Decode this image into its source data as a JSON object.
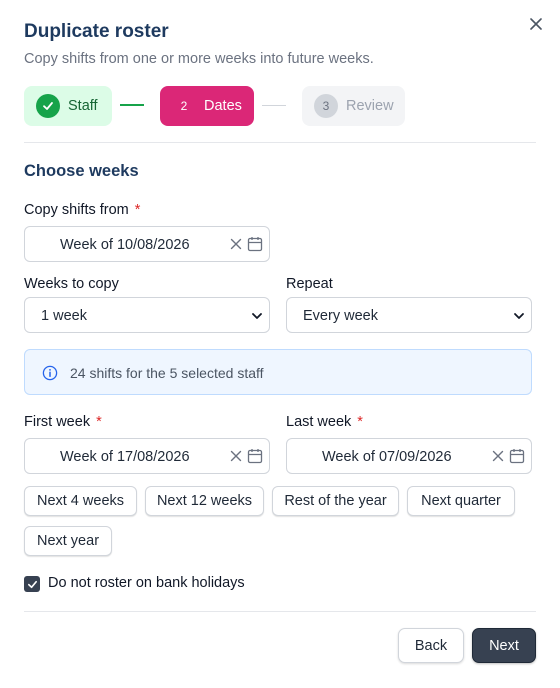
{
  "dialog": {
    "title": "Duplicate roster",
    "subtitle": "Copy shifts from one or more weeks into future weeks.",
    "close_icon": "close-icon"
  },
  "stepper": {
    "steps": [
      {
        "label": "Staff",
        "state": "complete",
        "icon": "check-icon"
      },
      {
        "number": "2",
        "label": "Dates",
        "state": "active"
      },
      {
        "number": "3",
        "label": "Review",
        "state": "upcoming"
      }
    ],
    "colors": {
      "complete": "#16a34a",
      "active": "#db2777",
      "upcoming": "#9ca3af"
    }
  },
  "section_title": "Choose weeks",
  "copy_from": {
    "label": "Copy shifts from",
    "required_mark": "*",
    "value": "Week of 10/08/2026"
  },
  "weeks_to_copy": {
    "label": "Weeks to copy",
    "value": "1 week"
  },
  "repeat": {
    "label": "Repeat",
    "value": "Every week"
  },
  "info": {
    "icon": "info-icon",
    "text": "24 shifts for the 5 selected staff"
  },
  "first_week": {
    "label": "First week",
    "required_mark": "*",
    "value": "Week of 17/08/2026"
  },
  "last_week": {
    "label": "Last week",
    "required_mark": "*",
    "value": "Week of 07/09/2026"
  },
  "quick_ranges": [
    "Next 4 weeks",
    "Next 12 weeks",
    "Rest of the year",
    "Next quarter",
    "Next year"
  ],
  "bank_holidays": {
    "label": "Do not roster on bank holidays",
    "checked": true
  },
  "footer": {
    "back_label": "Back",
    "next_label": "Next"
  }
}
